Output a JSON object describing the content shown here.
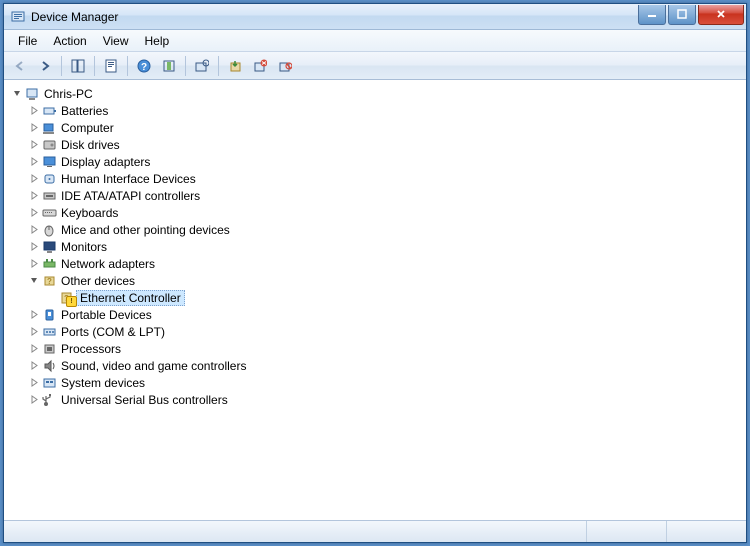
{
  "window": {
    "title": "Device Manager"
  },
  "menu": {
    "file": "File",
    "action": "Action",
    "view": "View",
    "help": "Help"
  },
  "tree": {
    "root": {
      "label": "Chris-PC",
      "expanded": true
    },
    "categories": [
      {
        "label": "Batteries",
        "icon": "battery"
      },
      {
        "label": "Computer",
        "icon": "computer"
      },
      {
        "label": "Disk drives",
        "icon": "disk"
      },
      {
        "label": "Display adapters",
        "icon": "display"
      },
      {
        "label": "Human Interface Devices",
        "icon": "hid"
      },
      {
        "label": "IDE ATA/ATAPI controllers",
        "icon": "ide"
      },
      {
        "label": "Keyboards",
        "icon": "keyboard"
      },
      {
        "label": "Mice and other pointing devices",
        "icon": "mouse"
      },
      {
        "label": "Monitors",
        "icon": "monitor"
      },
      {
        "label": "Network adapters",
        "icon": "network"
      },
      {
        "label": "Other devices",
        "icon": "other",
        "expanded": true,
        "children": [
          {
            "label": "Ethernet Controller",
            "icon": "unknown-warn",
            "selected": true
          }
        ]
      },
      {
        "label": "Portable Devices",
        "icon": "portable"
      },
      {
        "label": "Ports (COM & LPT)",
        "icon": "port"
      },
      {
        "label": "Processors",
        "icon": "cpu"
      },
      {
        "label": "Sound, video and game controllers",
        "icon": "sound"
      },
      {
        "label": "System devices",
        "icon": "system"
      },
      {
        "label": "Universal Serial Bus controllers",
        "icon": "usb"
      }
    ]
  }
}
